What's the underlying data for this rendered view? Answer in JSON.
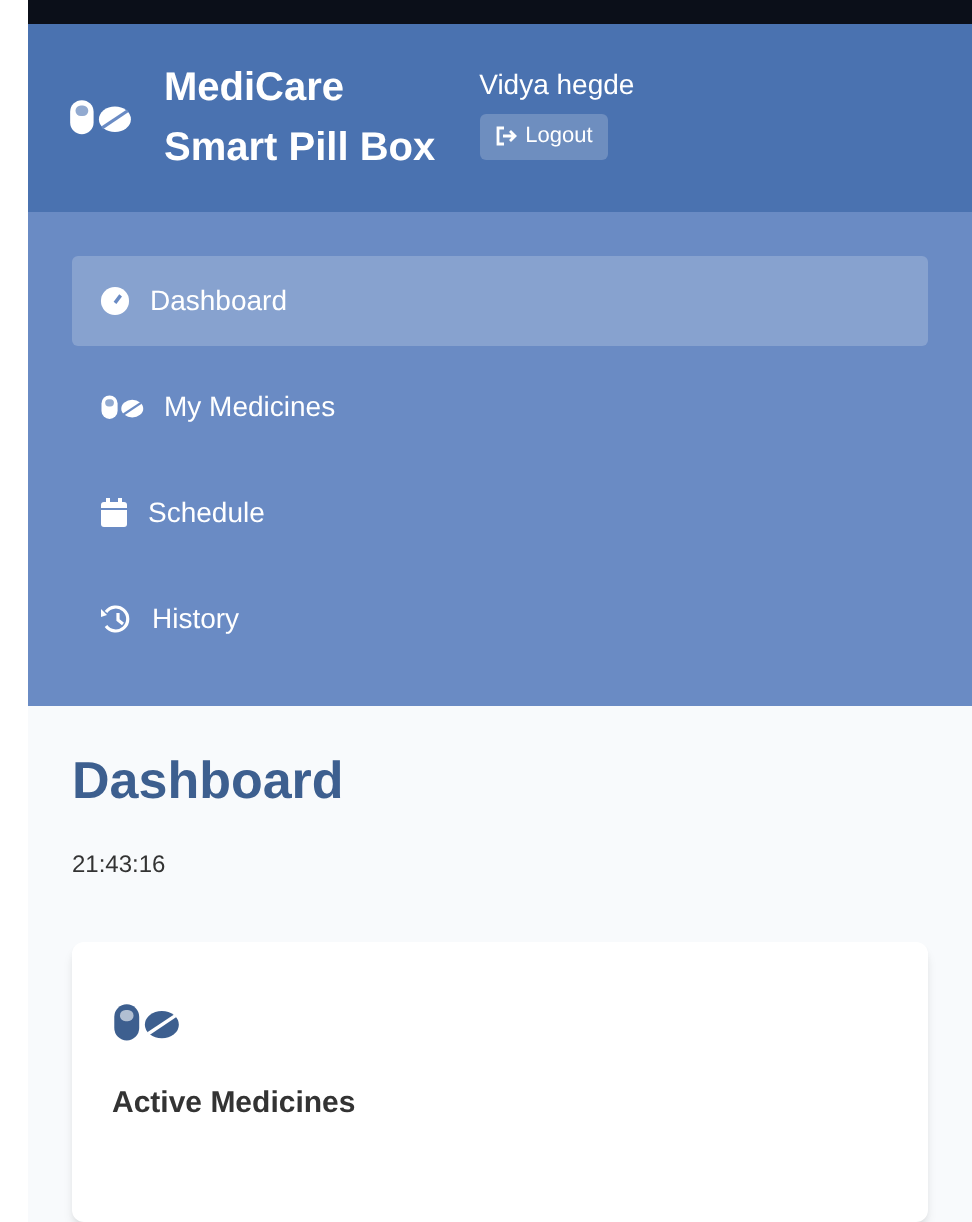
{
  "header": {
    "title_line_1": "MediCare",
    "title_line_2": "Smart Pill Box",
    "user_name": "Vidya hegde",
    "logout_label": "Logout"
  },
  "nav": [
    {
      "label": "Dashboard",
      "selected": true
    },
    {
      "label": "My Medicines",
      "selected": false
    },
    {
      "label": "Schedule",
      "selected": false
    },
    {
      "label": "History",
      "selected": false
    }
  ],
  "main": {
    "title": "Dashboard",
    "time": "21:43:16",
    "cards": [
      {
        "label": "Active Medicines"
      }
    ]
  }
}
